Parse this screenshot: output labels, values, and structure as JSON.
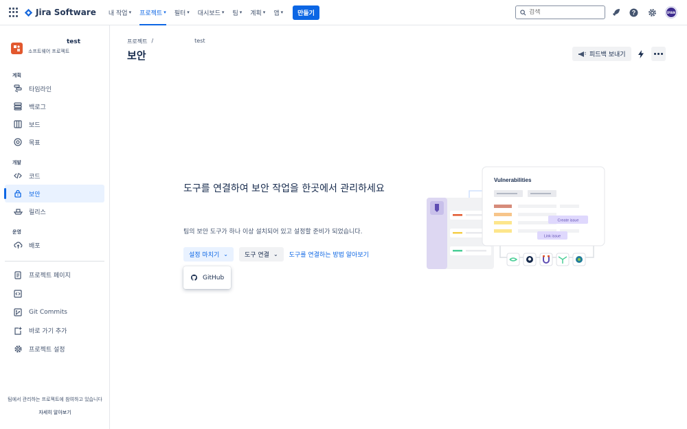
{
  "topnav": {
    "brand": "Jira Software",
    "items": [
      {
        "label": "내 작업"
      },
      {
        "label": "프로젝트"
      },
      {
        "label": "필터"
      },
      {
        "label": "대시보드"
      },
      {
        "label": "팀"
      },
      {
        "label": "계획"
      },
      {
        "label": "앱"
      }
    ],
    "create_label": "만들기",
    "search_placeholder": "검색",
    "avatar_initials": "DYAN"
  },
  "sidebar": {
    "project_name": "test",
    "project_type": "소프트웨어 프로젝트",
    "sections": [
      {
        "label": "계획",
        "items": [
          {
            "label": "타임라인",
            "icon": "timeline-icon"
          },
          {
            "label": "백로그",
            "icon": "backlog-icon"
          },
          {
            "label": "보드",
            "icon": "board-icon"
          },
          {
            "label": "목표",
            "icon": "goals-icon"
          }
        ]
      },
      {
        "label": "개발",
        "items": [
          {
            "label": "코드",
            "icon": "code-icon"
          },
          {
            "label": "보안",
            "icon": "lock-icon"
          },
          {
            "label": "릴리스",
            "icon": "ship-icon"
          }
        ]
      },
      {
        "label": "운영",
        "items": [
          {
            "label": "배포",
            "icon": "cloud-upload-icon"
          }
        ]
      }
    ],
    "extra_items": [
      {
        "label": "프로젝트 페이지",
        "icon": "page-icon"
      },
      {
        "label": "",
        "icon": "code-embed-icon"
      },
      {
        "label": "Git Commits",
        "icon": "git-icon"
      },
      {
        "label": "바로 가기 추가",
        "icon": "add-shortcut-icon"
      },
      {
        "label": "프로젝트 설정",
        "icon": "settings-icon"
      }
    ],
    "footer_text": "팀에서 관리하는 프로젝트에 참여하고 있습니다",
    "footer_link": "자세히 알아보기"
  },
  "main": {
    "breadcrumb": {
      "root": "프로젝트",
      "separator": "/",
      "project": "test"
    },
    "title": "보안",
    "feedback_label": "피드백 보내기",
    "heading": "도구를 연결하여 보안 작업을 한곳에서 관리하세요",
    "description": "팀의 보안 도구가 하나 이상 설치되어 있고 설정할 준비가 되었습니다.",
    "finish_setup_label": "설정 마치기",
    "connect_tool_label": "도구 연결",
    "learn_link": "도구를 연결하는 방법 알아보기",
    "dropdown_item": "GitHub"
  },
  "illustration": {
    "card_title": "Vulnerabilities",
    "create_issue": "Create issue",
    "link_issue": "Link issue"
  },
  "colors": {
    "accent": "#0c66e4",
    "project_avatar": "#e2582e"
  }
}
